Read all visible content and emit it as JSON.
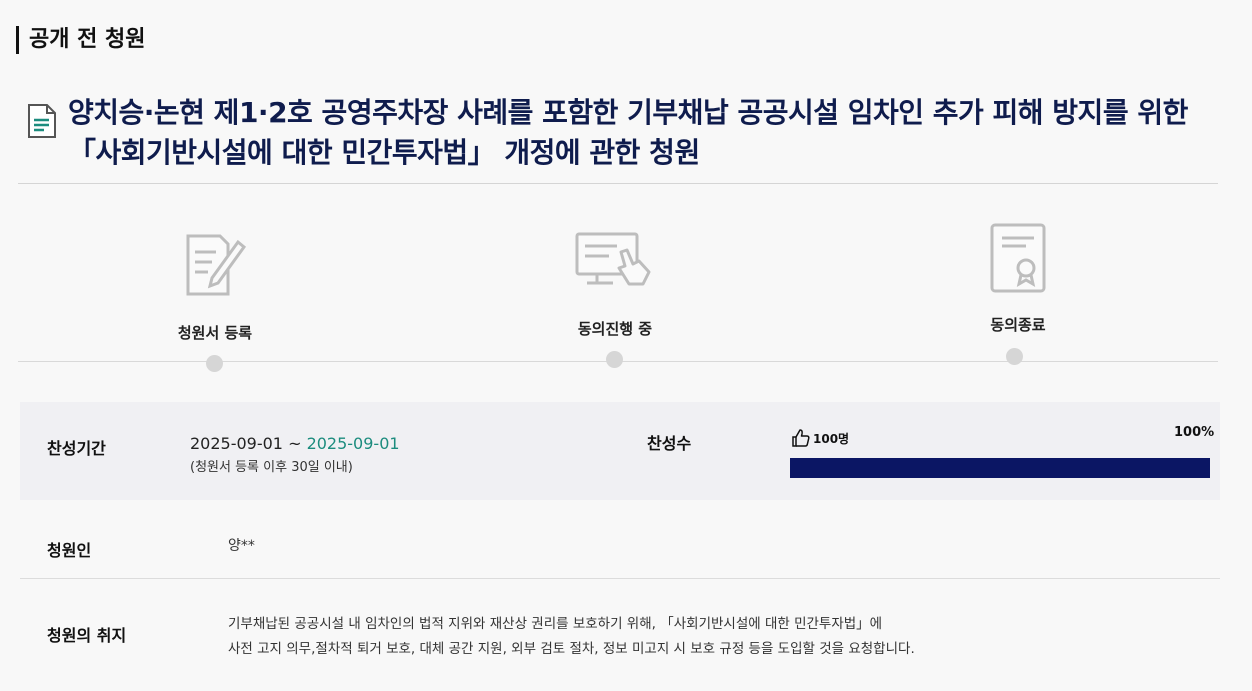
{
  "section": {
    "title": "공개 전 청원"
  },
  "petition": {
    "title": "양치승·논현 제1·2호 공영주차장 사례를 포함한 기부채납 공공시설 임차인 추가 피해 방지를 위한 「사회기반시설에 대한 민간투자법」 개정에 관한 청원"
  },
  "steps": [
    {
      "label": "청원서 등록",
      "icon": "document-pen-icon"
    },
    {
      "label": "동의진행 중",
      "icon": "monitor-touch-icon"
    },
    {
      "label": "동의종료",
      "icon": "certificate-icon"
    }
  ],
  "info": {
    "period_label": "찬성기간",
    "period_start": "2025-09-01 ~ ",
    "period_end": "2025-09-01",
    "period_note": "(청원서 등록 이후 30일 이내)",
    "support_label": "찬성수",
    "support_count": "100명",
    "support_percent_text": "100%",
    "support_fraction": 1.0,
    "bar_color": "#0b1664"
  },
  "petitioner": {
    "label": "청원인",
    "value": "양**"
  },
  "purpose": {
    "label": "청원의 취지",
    "line1": "기부채납된 공공시설 내 임차인의 법적 지위와 재산상 권리를 보호하기 위해, 「사회기반시설에 대한 민간투자법」에",
    "line2": "사전 고지 의무,절차적 퇴거 보호, 대체 공간 지원, 외부 검토 절차, 정보 미고지 시 보호 규정 등을 도입할 것을 요청합니다."
  }
}
